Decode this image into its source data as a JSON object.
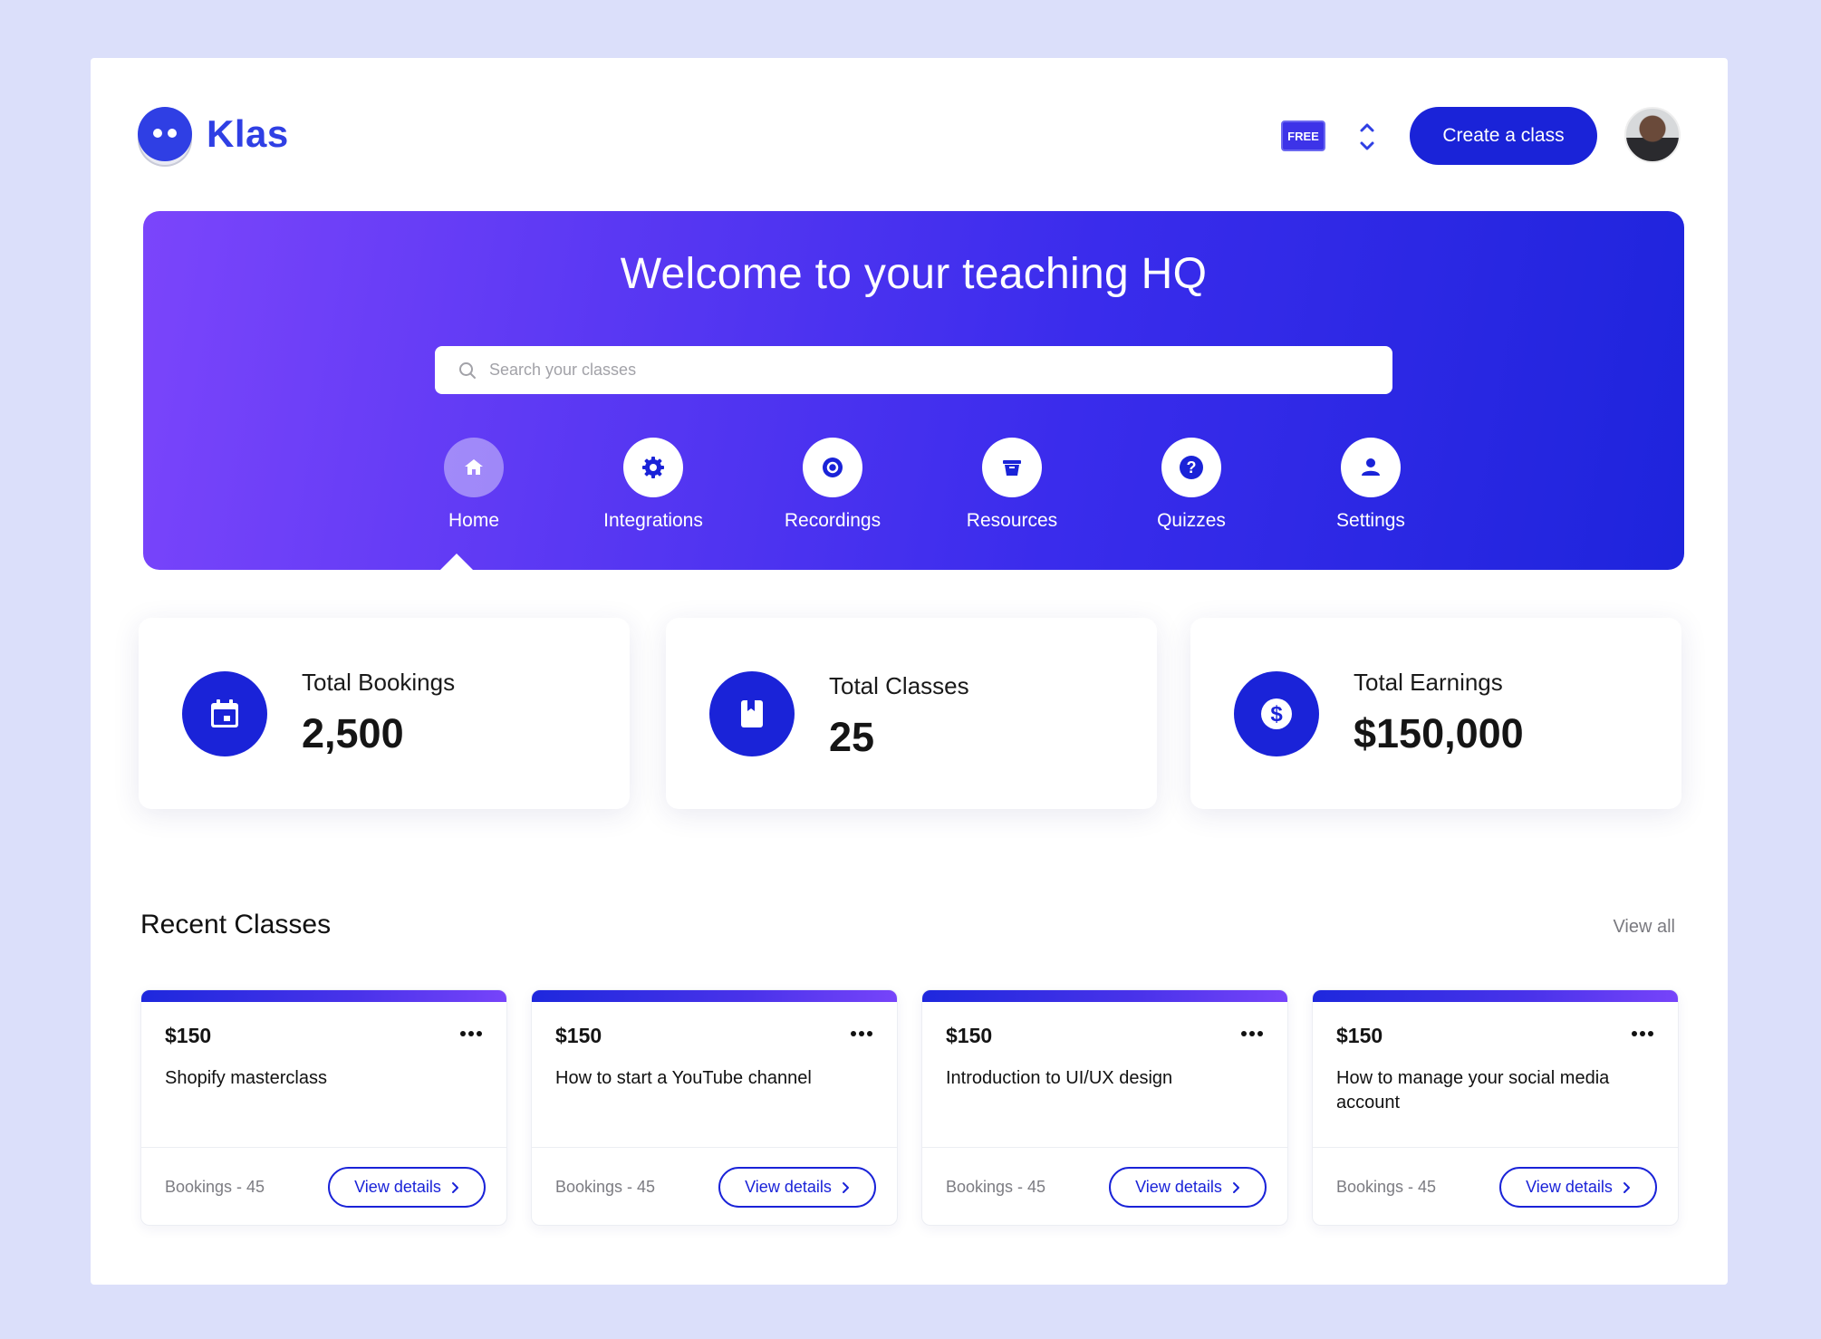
{
  "app": {
    "name": "Klas"
  },
  "header": {
    "plan_badge": "FREE",
    "create_button": "Create a class",
    "icons": {
      "logo": "klas-logo-icon",
      "switcher": "chevron-up-down-icon",
      "avatar": "user-avatar"
    }
  },
  "hero": {
    "title": "Welcome to your teaching HQ",
    "search_placeholder": "Search your classes",
    "nav": [
      {
        "label": "Home",
        "icon": "home-icon",
        "active": true
      },
      {
        "label": "Integrations",
        "icon": "gear-icon",
        "active": false
      },
      {
        "label": "Recordings",
        "icon": "record-icon",
        "active": false
      },
      {
        "label": "Resources",
        "icon": "basket-icon",
        "active": false
      },
      {
        "label": "Quizzes",
        "icon": "question-icon",
        "active": false
      },
      {
        "label": "Settings",
        "icon": "user-icon",
        "active": false
      }
    ]
  },
  "stats": [
    {
      "label": "Total Bookings",
      "value": "2,500",
      "icon": "calendar-icon"
    },
    {
      "label": "Total Classes",
      "value": "25",
      "icon": "book-icon"
    },
    {
      "label": "Total Earnings",
      "value": "$150,000",
      "icon": "dollar-icon"
    }
  ],
  "recent": {
    "title": "Recent Classes",
    "view_all": "View all",
    "classes": [
      {
        "price": "$150",
        "title": "Shopify masterclass",
        "bookings": "Bookings - 45",
        "button": "View details"
      },
      {
        "price": "$150",
        "title": "How to start a YouTube channel",
        "bookings": "Bookings - 45",
        "button": "View details"
      },
      {
        "price": "$150",
        "title": "Introduction to UI/UX design",
        "bookings": "Bookings - 45",
        "button": "View details"
      },
      {
        "price": "$150",
        "title": "How to manage your social media account",
        "bookings": "Bookings - 45",
        "button": "View details"
      }
    ]
  },
  "colors": {
    "brand": "#1a23d8",
    "hero_start": "#7b45fb",
    "hero_end": "#1e24dc",
    "background": "#dbdffa"
  }
}
